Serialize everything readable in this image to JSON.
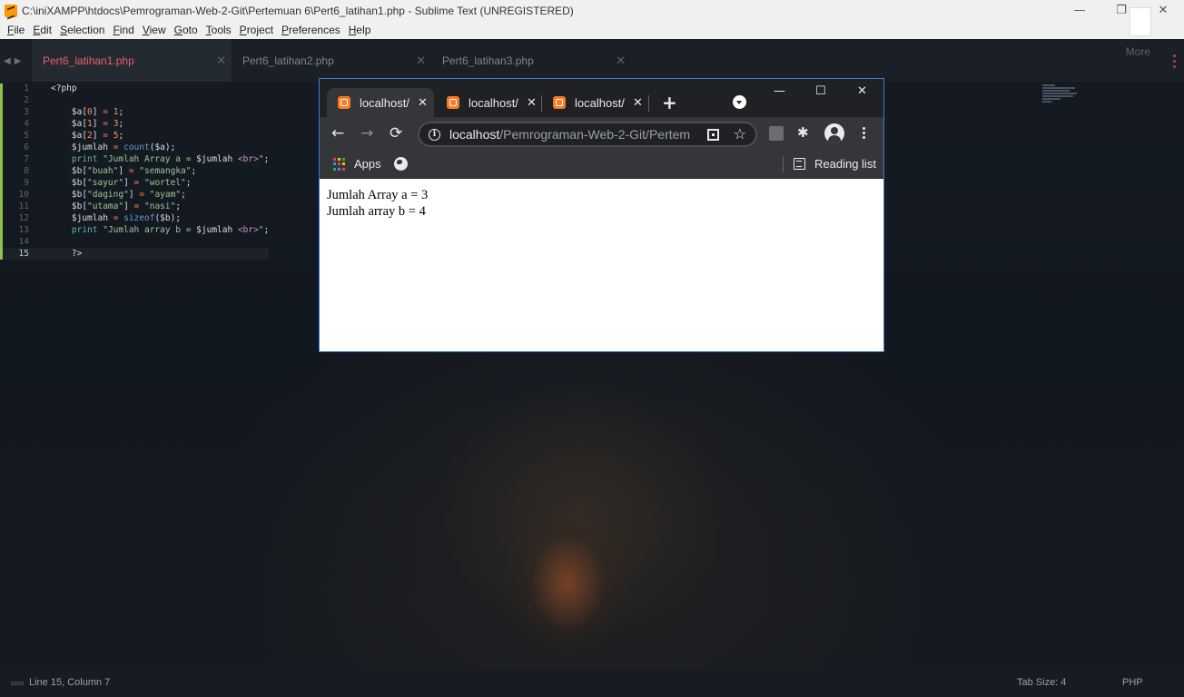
{
  "sublime": {
    "title": "C:\\iniXAMPP\\htdocs\\Pemrograman-Web-2-Git\\Pertemuan 6\\Pert6_latihan1.php - Sublime Text (UNREGISTERED)",
    "window_controls": {
      "minimize": "—",
      "restore": "❐",
      "close": "✕"
    },
    "menu": [
      {
        "u": "F",
        "rest": "ile"
      },
      {
        "u": "E",
        "rest": "dit"
      },
      {
        "u": "S",
        "rest": "election"
      },
      {
        "u": "F",
        "rest": "ind"
      },
      {
        "u": "V",
        "rest": "iew"
      },
      {
        "u": "G",
        "rest": "oto"
      },
      {
        "u": "T",
        "rest": "ools"
      },
      {
        "u": "P",
        "rest": "roject"
      },
      {
        "u": "P",
        "rest": "references"
      },
      {
        "u": "H",
        "rest": "elp"
      }
    ],
    "more_label": "More",
    "tabs": [
      {
        "label": "Pert6_latihan1.php",
        "active": true
      },
      {
        "label": "Pert6_latihan2.php",
        "active": false
      },
      {
        "label": "Pert6_latihan3.php",
        "active": false
      }
    ],
    "tab_close_glyph": "✕",
    "tab_nav": "◀▶",
    "line_numbers": [
      "1",
      "2",
      "3",
      "4",
      "5",
      "6",
      "7",
      "8",
      "9",
      "10",
      "11",
      "12",
      "13",
      "14",
      "15"
    ],
    "current_line": 15,
    "status": {
      "position": "Line 15, Column 7",
      "tab_size": "Tab Size: 4",
      "syntax": "PHP"
    }
  },
  "code_lines": [
    [
      {
        "t": "<?php",
        "c": "var"
      }
    ],
    [],
    [
      {
        "t": "    $a[",
        "c": "var"
      },
      {
        "t": "0",
        "c": "num"
      },
      {
        "t": "] ",
        "c": "var"
      },
      {
        "t": "=",
        "c": "op"
      },
      {
        "t": " ",
        "c": "var"
      },
      {
        "t": "1",
        "c": "num"
      },
      {
        "t": ";",
        "c": "var"
      }
    ],
    [
      {
        "t": "    $a[",
        "c": "var"
      },
      {
        "t": "1",
        "c": "num"
      },
      {
        "t": "] ",
        "c": "var"
      },
      {
        "t": "=",
        "c": "op"
      },
      {
        "t": " ",
        "c": "var"
      },
      {
        "t": "3",
        "c": "num"
      },
      {
        "t": ";",
        "c": "var"
      }
    ],
    [
      {
        "t": "    $a[",
        "c": "var"
      },
      {
        "t": "2",
        "c": "num"
      },
      {
        "t": "] ",
        "c": "var"
      },
      {
        "t": "=",
        "c": "op"
      },
      {
        "t": " ",
        "c": "var"
      },
      {
        "t": "5",
        "c": "num"
      },
      {
        "t": ";",
        "c": "var"
      }
    ],
    [
      {
        "t": "    $jumlah ",
        "c": "var"
      },
      {
        "t": "=",
        "c": "op"
      },
      {
        "t": " ",
        "c": "var"
      },
      {
        "t": "count",
        "c": "fn"
      },
      {
        "t": "($a);",
        "c": "var"
      }
    ],
    [
      {
        "t": "    ",
        "c": "var"
      },
      {
        "t": "print",
        "c": "kw"
      },
      {
        "t": " \"Jumlah Array a = ",
        "c": "str"
      },
      {
        "t": "$jumlah",
        "c": "var"
      },
      {
        "t": " <br>",
        "c": "tag"
      },
      {
        "t": "\"",
        "c": "str"
      },
      {
        "t": ";",
        "c": "var"
      }
    ],
    [
      {
        "t": "    $b[",
        "c": "var"
      },
      {
        "t": "\"buah\"",
        "c": "str"
      },
      {
        "t": "] ",
        "c": "var"
      },
      {
        "t": "=",
        "c": "op"
      },
      {
        "t": " ",
        "c": "var"
      },
      {
        "t": "\"semangka\"",
        "c": "str"
      },
      {
        "t": ";",
        "c": "var"
      }
    ],
    [
      {
        "t": "    $b[",
        "c": "var"
      },
      {
        "t": "\"sayur\"",
        "c": "str"
      },
      {
        "t": "] ",
        "c": "var"
      },
      {
        "t": "=",
        "c": "op"
      },
      {
        "t": " ",
        "c": "var"
      },
      {
        "t": "\"wortel\"",
        "c": "str"
      },
      {
        "t": ";",
        "c": "var"
      }
    ],
    [
      {
        "t": "    $b[",
        "c": "var"
      },
      {
        "t": "\"daging\"",
        "c": "str"
      },
      {
        "t": "] ",
        "c": "var"
      },
      {
        "t": "=",
        "c": "op"
      },
      {
        "t": " ",
        "c": "var"
      },
      {
        "t": "\"ayam\"",
        "c": "str"
      },
      {
        "t": ";",
        "c": "var"
      }
    ],
    [
      {
        "t": "    $b[",
        "c": "var"
      },
      {
        "t": "\"utama\"",
        "c": "str"
      },
      {
        "t": "] ",
        "c": "var"
      },
      {
        "t": "=",
        "c": "op"
      },
      {
        "t": " ",
        "c": "var"
      },
      {
        "t": "\"nasi\"",
        "c": "str"
      },
      {
        "t": ";",
        "c": "var"
      }
    ],
    [
      {
        "t": "    $jumlah ",
        "c": "var"
      },
      {
        "t": "=",
        "c": "op"
      },
      {
        "t": " ",
        "c": "var"
      },
      {
        "t": "sizeof",
        "c": "fn"
      },
      {
        "t": "($b);",
        "c": "var"
      }
    ],
    [
      {
        "t": "    ",
        "c": "var"
      },
      {
        "t": "print",
        "c": "kw"
      },
      {
        "t": " \"Jumlah array b = ",
        "c": "str"
      },
      {
        "t": "$jumlah",
        "c": "var"
      },
      {
        "t": " <br>",
        "c": "tag"
      },
      {
        "t": "\"",
        "c": "str"
      },
      {
        "t": ";",
        "c": "var"
      }
    ],
    [],
    [
      {
        "t": "    ?>",
        "c": "var"
      }
    ]
  ],
  "browser": {
    "tabs": [
      {
        "label": "localhost/",
        "active": true
      },
      {
        "label": "localhost/",
        "active": false
      },
      {
        "label": "localhost/",
        "active": false
      }
    ],
    "tab_close_glyph": "✕",
    "new_tab_glyph": "+",
    "window_controls": {
      "minimize": "—",
      "maximize": "☐",
      "close": "✕"
    },
    "nav": {
      "back": "←",
      "forward": "→",
      "reload": "⟳"
    },
    "url_host": "localhost",
    "url_path": "/Pemrograman-Web-2-Git/Pertem",
    "star_glyph": "☆",
    "puzzle_glyph": "✱",
    "bookmarks": {
      "apps": "Apps",
      "reading_list": "Reading list"
    },
    "apps_colors": [
      "#ea4335",
      "#fbbc04",
      "#34a853",
      "#4285f4",
      "#ea4335",
      "#fbbc04",
      "#34a853",
      "#4285f4",
      "#ea4335"
    ],
    "page_lines": [
      "Jumlah Array a = 3",
      "Jumlah array b = 4"
    ]
  },
  "colors": {
    "accent_tab": "#ec5f67",
    "gutter_mark": "#8bc34a",
    "chrome_focus": "#3b7bd4",
    "xampp_orange": "#fb7a24"
  }
}
